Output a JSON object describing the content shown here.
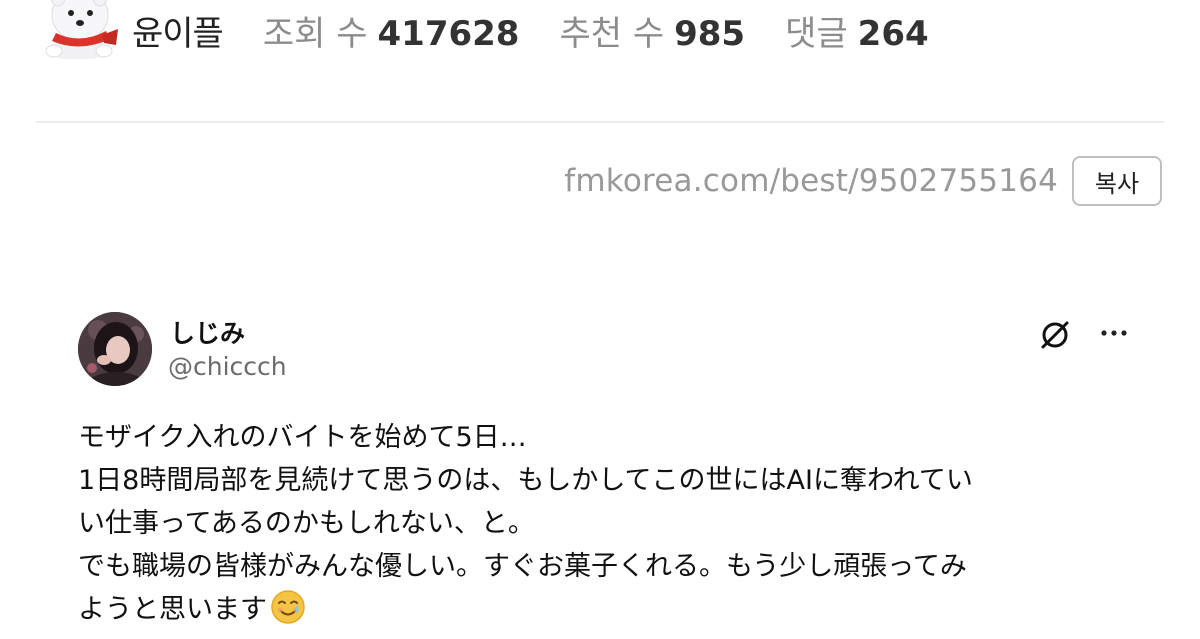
{
  "post_stats": {
    "author_nickname": "윤이플",
    "views_label": "조회 수",
    "views_value": "417628",
    "recommend_label": "추천 수",
    "recommend_value": "985",
    "comments_label": "댓글",
    "comments_value": "264"
  },
  "share": {
    "url": "fmkorea.com/best/9502755164",
    "copy_label": "복사"
  },
  "tweet": {
    "display_name": "しじみ",
    "handle": "@chiccch",
    "lines": [
      "モザイク入れのバイトを始めて5日…",
      "1日8時間局部を見続けて思うのは、もしかしてこの世にはAIに奪われてい",
      "い仕事ってあるのかもしれない、と。",
      "でも職場の皆様がみんな優しい。すぐお菓子くれる。もう少し頑張ってみ",
      "ようと思います"
    ],
    "emoji": "smiling-face-with-tear-icon"
  },
  "icons": {
    "author_avatar": "white-dog-mascot-icon",
    "grok": "grok-icon",
    "more": "more-options-icon"
  },
  "colors": {
    "stat_label": "#8c8c8c",
    "stat_value": "#333333",
    "url_text": "#999999",
    "handle": "#6b6b6b",
    "divider": "#ececec"
  }
}
